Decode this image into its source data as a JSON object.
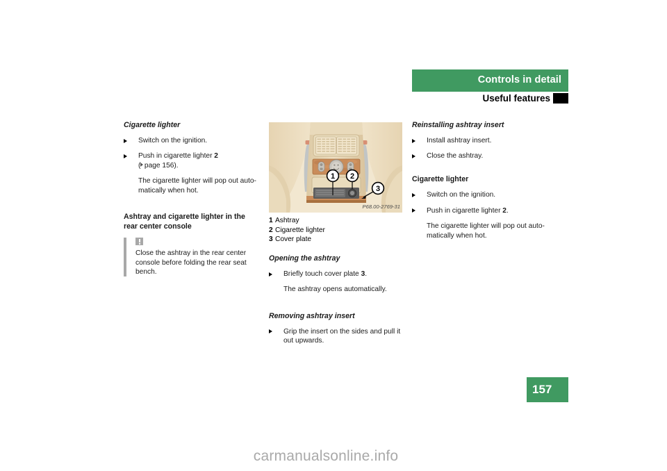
{
  "header": {
    "chapter_title": "Controls in detail",
    "section_title": "Useful features",
    "bar_color": "#409a61"
  },
  "left_column": {
    "heading_1": "Cigarette lighter",
    "steps_1": [
      {
        "text_before": "Switch on the ignition.",
        "bold": "",
        "text_after": ""
      },
      {
        "text_before": "Push in cigarette lighter ",
        "bold": "2",
        "text_after": ""
      }
    ],
    "pageref": "page 156).",
    "pageref_open": "(",
    "note_after_steps": "The cigarette lighter will pop out auto-matically when hot.",
    "heading_2": "Ashtray and cigarette lighter in the rear center console",
    "warning_text": "Close the ashtray in the rear center console before folding the rear seat bench."
  },
  "figure": {
    "image_id": "P68.00-2769-31",
    "callouts": [
      "1",
      "2",
      "3"
    ],
    "captions": [
      {
        "number": "1",
        "label": "Ashtray"
      },
      {
        "number": "2",
        "label": "Cigarette lighter"
      },
      {
        "number": "3",
        "label": "Cover plate"
      }
    ]
  },
  "mid_column": {
    "heading_1": "Opening the ashtray",
    "step_1_before": "Briefly touch cover plate ",
    "step_1_bold": "3",
    "step_1_after": ".",
    "result_1": "The ashtray opens automatically.",
    "heading_2": "Removing ashtray insert",
    "step_2": "Grip the insert on the sides and pull it out upwards."
  },
  "right_column": {
    "heading_1": "Reinstalling ashtray insert",
    "step_1": "Install ashtray insert.",
    "step_2": "Close the ashtray.",
    "heading_2": "Cigarette lighter",
    "step_3": "Switch on the ignition.",
    "step_4_before": "Push in cigarette lighter ",
    "step_4_bold": "2",
    "step_4_after": ".",
    "result": "The cigarette lighter will pop out auto-matically when hot."
  },
  "page_number": "157",
  "footer": {
    "watermark": "carmanualsonline.info"
  }
}
